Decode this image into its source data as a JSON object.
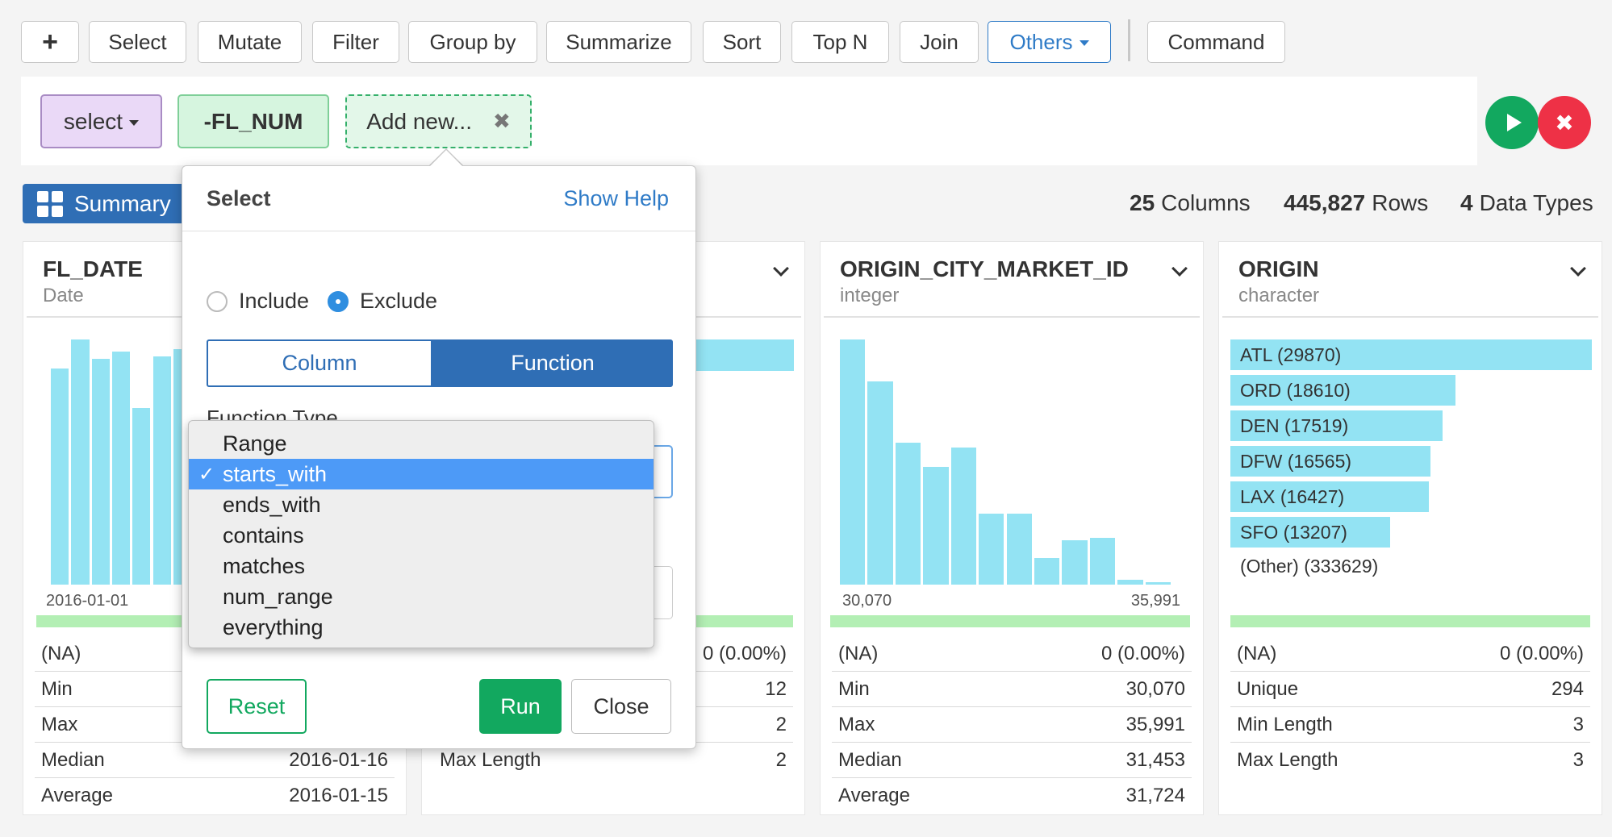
{
  "toolbar": {
    "plus": "+",
    "buttons": [
      "Select",
      "Mutate",
      "Filter",
      "Group by",
      "Summarize",
      "Sort",
      "Top N",
      "Join",
      "Others",
      "Command"
    ]
  },
  "command": {
    "verb": "select",
    "column_token": "-FL_NUM",
    "add_new": "Add new...",
    "add_new_close": "✖",
    "run_icon": "play-icon",
    "cancel_icon": "close-icon",
    "cancel_glyph": "✖"
  },
  "summary": {
    "button_label": "Summary",
    "columns_count": "25",
    "columns_label": "Columns",
    "rows_count": "445,827",
    "rows_label": "Rows",
    "types_count": "4",
    "types_label": "Data Types"
  },
  "cards": {
    "fl_date": {
      "name": "FL_DATE",
      "type": "Date",
      "axis_min": "2016-01-01",
      "histogram": [
        0.88,
        1.0,
        0.92,
        0.95,
        0.72,
        0.93,
        0.96,
        0.94,
        0.5,
        0.4
      ],
      "rows": [
        {
          "label": "(NA)",
          "value": ""
        },
        {
          "label": "Min",
          "value": ""
        },
        {
          "label": "Max",
          "value": ""
        },
        {
          "label": "Median",
          "value": "2016-01-16"
        },
        {
          "label": "Average",
          "value": "2016-01-15"
        }
      ]
    },
    "second": {
      "top_bar_fraction": 1.0,
      "rows": [
        {
          "label": "",
          "value": "0 (0.00%)"
        },
        {
          "label": "",
          "value": "12"
        },
        {
          "label": "",
          "value": "2"
        },
        {
          "label": "Max Length",
          "value": "2"
        }
      ]
    },
    "origin_city": {
      "name": "ORIGIN_CITY_MARKET_ID",
      "type": "integer",
      "axis_min": "30,070",
      "axis_max": "35,991",
      "histogram": [
        1.0,
        0.83,
        0.58,
        0.48,
        0.56,
        0.29,
        0.29,
        0.11,
        0.18,
        0.19,
        0.02,
        0.01
      ],
      "rows": [
        {
          "label": "(NA)",
          "value": "0 (0.00%)"
        },
        {
          "label": "Min",
          "value": "30,070"
        },
        {
          "label": "Max",
          "value": "35,991"
        },
        {
          "label": "Median",
          "value": "31,453"
        },
        {
          "label": "Average",
          "value": "31,724"
        }
      ]
    },
    "origin": {
      "name": "ORIGIN",
      "type": "character",
      "categories": [
        {
          "label": "ATL (29870)",
          "count": 29870
        },
        {
          "label": "ORD (18610)",
          "count": 18610
        },
        {
          "label": "DEN (17519)",
          "count": 17519
        },
        {
          "label": "DFW (16565)",
          "count": 16565
        },
        {
          "label": "LAX (16427)",
          "count": 16427
        },
        {
          "label": "SFO (13207)",
          "count": 13207
        }
      ],
      "other": "(Other) (333629)",
      "rows": [
        {
          "label": "(NA)",
          "value": "0 (0.00%)"
        },
        {
          "label": "Unique",
          "value": "294"
        },
        {
          "label": "Min Length",
          "value": "3"
        },
        {
          "label": "Max Length",
          "value": "3"
        }
      ]
    }
  },
  "popover": {
    "title": "Select",
    "help": "Show Help",
    "radio_include": "Include",
    "radio_exclude": "Exclude",
    "radio_selected": "Exclude",
    "tab_column": "Column",
    "tab_function": "Function",
    "function_type_label": "Function Type",
    "reset": "Reset",
    "run": "Run",
    "close": "Close"
  },
  "dropdown": {
    "options": [
      "Range",
      "starts_with",
      "ends_with",
      "contains",
      "matches",
      "num_range",
      "everything"
    ],
    "selected": "starts_with",
    "check": "✓"
  },
  "colors": {
    "accent_blue": "#2f6eb5",
    "green": "#12a85f",
    "red": "#ee3146",
    "bar": "#93e3f3",
    "selection": "#4d9af7"
  }
}
